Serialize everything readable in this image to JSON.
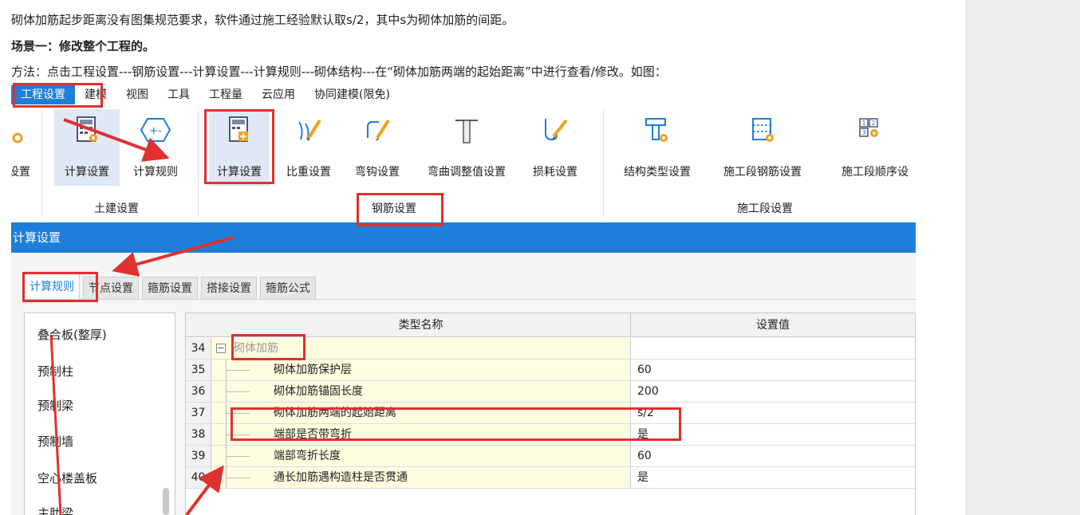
{
  "doc": {
    "line1": "砌体加筋起步距离没有图集规范要求，软件通过施工经验默认取s/2，其中s为砌体加筋的间距。",
    "line2": "场景一：修改整个工程的。",
    "line3": "方法：点击工程设置---钢筋设置---计算设置---计算规则---砌体结构---在“砌体加筋两端的起始距离”中进行查看/修改。如图："
  },
  "menubar": {
    "items": [
      "工程设置",
      "建模",
      "视图",
      "工具",
      "工程量",
      "云应用",
      "协同建模(限免)"
    ]
  },
  "ribbon": {
    "groups": {
      "tujian": {
        "label": "土建设置",
        "partial_label": "设置",
        "calc_settings": "计算设置",
        "calc_rules": "计算规则"
      },
      "gangjin": {
        "label": "钢筋设置",
        "calc_settings": "计算设置",
        "weight_settings": "比重设置",
        "hook_settings": "弯钩设置",
        "bend_adjust": "弯曲调整值设置",
        "loss_settings": "损耗设置"
      },
      "shigongduan": {
        "label": "施工段设置",
        "struct_type": "结构类型设置",
        "seg_rebar": "施工段钢筋设置",
        "seg_order": "施工段顺序设"
      }
    }
  },
  "dialog": {
    "title": "计算设置",
    "tabs": [
      "计算规则",
      "节点设置",
      "箍筋设置",
      "搭接设置",
      "箍筋公式"
    ]
  },
  "left_list": {
    "items": [
      "叠合板(整厚)",
      "预制柱",
      "预制梁",
      "预制墙",
      "空心楼盖板",
      "主肋梁"
    ]
  },
  "grid": {
    "headers": {
      "name": "类型名称",
      "value": "设置值"
    },
    "group_row": {
      "num": "34",
      "name": "砌体加筋"
    },
    "rows": [
      {
        "num": "35",
        "name": "砌体加筋保护层",
        "value": "60"
      },
      {
        "num": "36",
        "name": "砌体加筋锚固长度",
        "value": "200"
      },
      {
        "num": "37",
        "name": "砌体加筋两端的起始距离",
        "value": "s/2"
      },
      {
        "num": "38",
        "name": "端部是否带弯折",
        "value": "是"
      },
      {
        "num": "39",
        "name": "端部弯折长度",
        "value": "60"
      },
      {
        "num": "40",
        "name": "通长加筋遇构造柱是否贯通",
        "value": "是"
      }
    ]
  },
  "colors": {
    "accent_blue": "#1d7fd9",
    "annotation_red": "#e03030",
    "highlight_yellow": "#fffde0"
  }
}
